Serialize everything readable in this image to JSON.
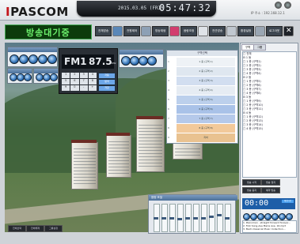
{
  "app": {
    "logo": "PASCOM",
    "status": "방송대기중",
    "datetime": "2015.03.05 (FRI)",
    "clock": "05:47:32",
    "ip": "IP 주소 : 192.168.12.1"
  },
  "toolbar": [
    "전체방송",
    "전원제어",
    "방송재생",
    "음량조정",
    "전관방송",
    "환경설정",
    "로그아웃"
  ],
  "fm": {
    "band": "FM1",
    "freq": "87.5",
    "unit": "MHz",
    "keys": [
      "1",
      "2",
      "3",
      "4",
      "5",
      "6",
      "7",
      "8",
      "9",
      "0",
      "-",
      "+"
    ],
    "btn1": "자동",
    "btn2": "탐색",
    "btn3": "저장"
  },
  "zones": {
    "title": "구역선택",
    "items": [
      {
        "num": "1",
        "label": "1 층 (구역 1)"
      },
      {
        "num": "2",
        "label": "2 층 (구역 2)"
      },
      {
        "num": "3",
        "label": "3 층 (구역 3)"
      },
      {
        "num": "4",
        "label": "4 층 (구역 4)"
      },
      {
        "num": "5",
        "label": "5 층 (구역 5)"
      },
      {
        "num": "6",
        "label": "6 층 (구역 6)"
      },
      {
        "num": "7",
        "label": "7 층 (구역 7)"
      },
      {
        "num": "8",
        "label": "8 층 (구역 8)"
      },
      {
        "num": "9",
        "label": "지하"
      }
    ]
  },
  "mixer": {
    "title": "음량 조절",
    "channels": [
      "1",
      "2",
      "3",
      "4",
      "5",
      "6",
      "7",
      "8",
      "9",
      "10"
    ],
    "levels": [
      0.5,
      0.5,
      0.5,
      0.45,
      0.5,
      0.5,
      0.5,
      0.55,
      0.6,
      0.5
    ]
  },
  "bottom": [
    "전체선택",
    "전체해제",
    "그룹설정"
  ],
  "right": {
    "tabs": [
      "구역",
      "그룹"
    ],
    "tree": [
      "□ 전체",
      "  ⊟ 1 동",
      "    □ 1 층 (구역1)",
      "    □ 2 층 (구역2)",
      "    □ 3 층 (구역3)",
      "    □ 4 층 (구역4)",
      "  ⊟ 2 동",
      "    □ 1 층 (구역5)",
      "    □ 2 층 (구역6)",
      "    □ 3 층 (구역7)",
      "    □ 4 층 (구역8)",
      "  ⊟ 3 동",
      "    □ 1 층 (구역9)",
      "    □ 2 층 (구역10)",
      "    □ 3 층 (구역11)",
      "  ⊟ 4 동",
      "    □ 1 층 (구역12)",
      "    □ 2 층 (구역13)",
      "    □ 3 층 (구역14)",
      "    □ 4 층 (구역15)"
    ],
    "buttons": [
      "방송 시작",
      "방송 정지",
      "방송 중지",
      "예약 방송"
    ],
    "timer": "00:00",
    "timer_btn": "재생시간",
    "playlist": [
      "1. Pianoman - straight forward forever...",
      "2. Folk Song-Ave Maria Ave. 16.mp3",
      "3. Bach-Classical Music Collection..."
    ]
  }
}
